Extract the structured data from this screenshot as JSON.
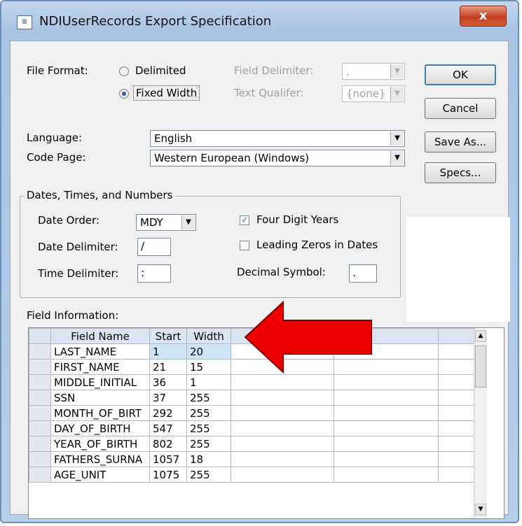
{
  "window": {
    "title": "NDIUserRecords Export Specification",
    "close_label": "x"
  },
  "file_format": {
    "label": "File Format:",
    "options": [
      {
        "label": "Delimited",
        "selected": false
      },
      {
        "label": "Fixed Width",
        "selected": true
      }
    ],
    "field_delimiter_label": "Field Delimiter:",
    "field_delimiter_value": ",",
    "text_qualifier_label": "Text Qualifer:",
    "text_qualifier_value": "{none}"
  },
  "buttons": {
    "ok": "OK",
    "cancel": "Cancel",
    "save_as": "Save As...",
    "specs": "Specs..."
  },
  "language": {
    "label": "Language:",
    "value": "English"
  },
  "code_page": {
    "label": "Code Page:",
    "value": "Western European (Windows)"
  },
  "dates_group": {
    "title": "Dates, Times, and Numbers",
    "date_order_label": "Date Order:",
    "date_order_value": "MDY",
    "date_delimiter_label": "Date Delimiter:",
    "date_delimiter_value": "/",
    "time_delimiter_label": "Time Delimiter:",
    "time_delimiter_value": ":",
    "four_digit_years_label": "Four Digit Years",
    "four_digit_years_checked": true,
    "leading_zeros_label": "Leading Zeros in Dates",
    "leading_zeros_checked": false,
    "decimal_symbol_label": "Decimal Symbol:",
    "decimal_symbol_value": "."
  },
  "field_info": {
    "label": "Field Information:",
    "columns": [
      "Field Name",
      "Start",
      "Width"
    ],
    "rows": [
      [
        "LAST_NAME",
        "1",
        "20"
      ],
      [
        "FIRST_NAME",
        "21",
        "15"
      ],
      [
        "MIDDLE_INITIAL",
        "36",
        "1"
      ],
      [
        "SSN",
        "37",
        "255"
      ],
      [
        "MONTH_OF_BIRT",
        "292",
        "255"
      ],
      [
        "DAY_OF_BIRTH",
        "547",
        "255"
      ],
      [
        "YEAR_OF_BIRTH",
        "802",
        "255"
      ],
      [
        "FATHERS_SURNA",
        "1057",
        "18"
      ],
      [
        "AGE_UNIT",
        "1075",
        "255"
      ]
    ]
  },
  "annotation": {
    "arrow_color": "#ee0000"
  }
}
